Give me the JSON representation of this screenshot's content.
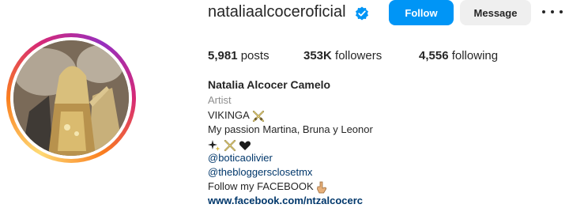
{
  "profile": {
    "username": "nataliaalcoceroficial",
    "verified_icon": "verified-badge-icon",
    "follow_label": "Follow",
    "message_label": "Message",
    "more_icon": "more-options-icon",
    "accent_color": "#0095f6"
  },
  "stats": {
    "posts_count": "5,981",
    "posts_label": "posts",
    "followers_count": "353K",
    "followers_label": "followers",
    "following_count": "4,556",
    "following_label": "following"
  },
  "bio": {
    "full_name": "Natalia Alcocer Camelo",
    "category": "Artist",
    "line1": "VIKINGA",
    "line2": "My passion Martina, Bruna y Leonor",
    "mention1": "@boticaolivier",
    "mention2": "@thebloggersclosetmx",
    "line3": "Follow my FACEBOOK",
    "link": "www.facebook.com/ntzalcocerc",
    "link_color": "#00376b"
  }
}
